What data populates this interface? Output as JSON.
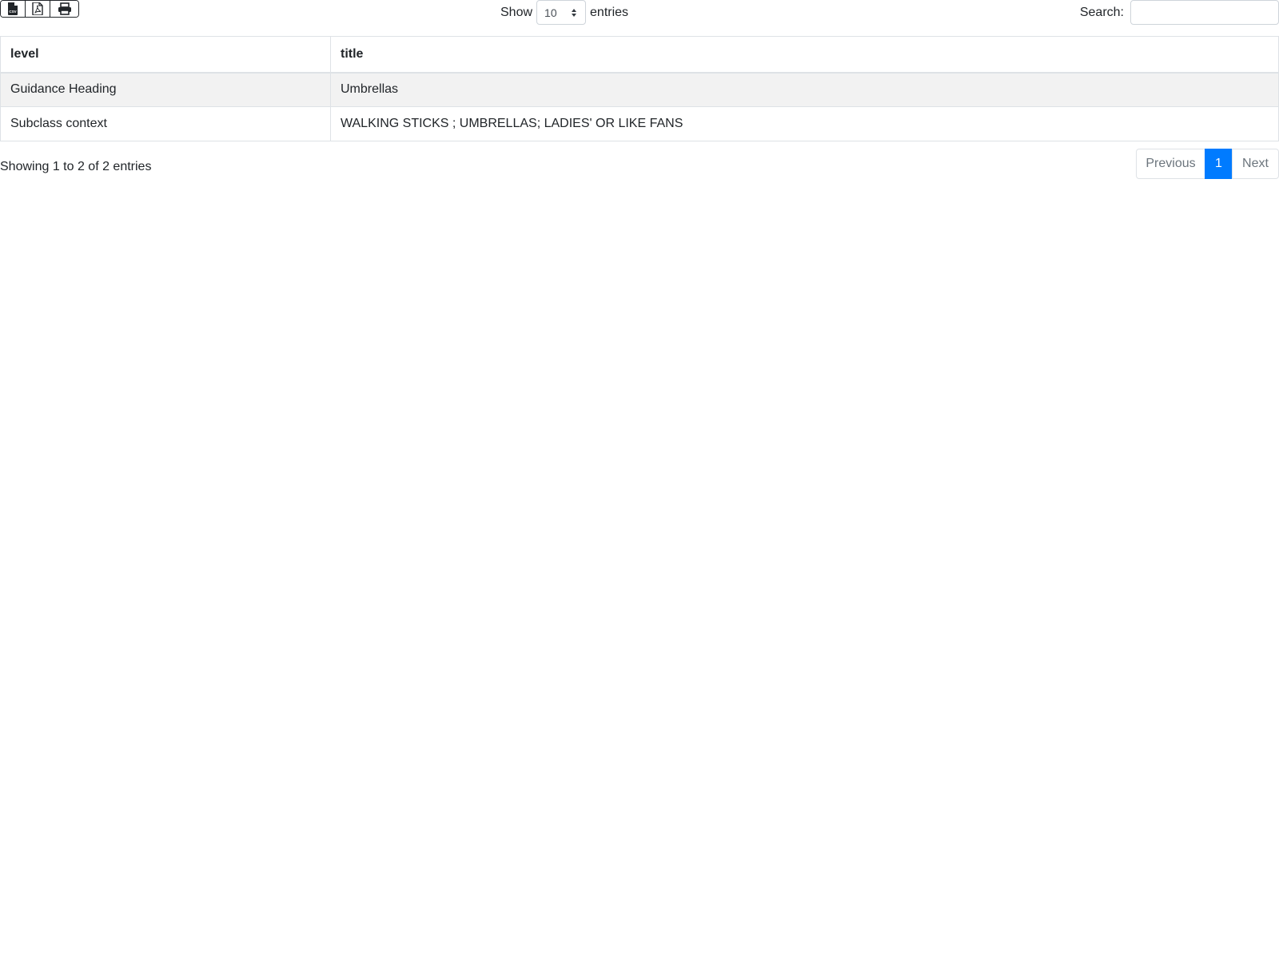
{
  "toolbar": {
    "export_buttons": [
      {
        "icon": "csv-file-icon"
      },
      {
        "icon": "pdf-file-icon"
      },
      {
        "icon": "print-icon"
      }
    ],
    "csv_icon_text": "CSV"
  },
  "length": {
    "label_before": "Show",
    "selected": "10",
    "label_after": "entries"
  },
  "search": {
    "label": "Search:",
    "value": "",
    "placeholder": ""
  },
  "table": {
    "headers": [
      "level",
      "title"
    ],
    "rows": [
      [
        "Guidance Heading",
        "Umbrellas"
      ],
      [
        "Subclass context",
        "WALKING STICKS ; UMBRELLAS; LADIES' OR LIKE FANS"
      ]
    ]
  },
  "info": {
    "text": "Showing 1 to 2 of 2 entries"
  },
  "pagination": {
    "previous": "Previous",
    "current": "1",
    "next": "Next",
    "accent_color": "#007bff"
  }
}
